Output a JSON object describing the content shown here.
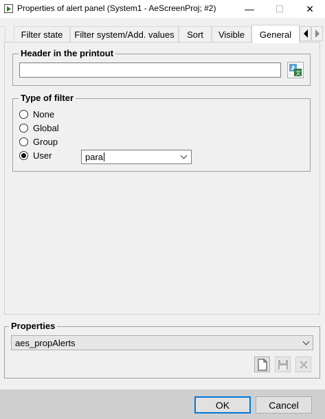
{
  "window": {
    "title": "Properties of alert panel (System1 - AeScreenProj; #2)",
    "minimize_glyph": "—",
    "maximize_glyph": "☐",
    "close_glyph": "✕"
  },
  "tabs": [
    {
      "label": "Filter state"
    },
    {
      "label": "Filter system/Add. values"
    },
    {
      "label": "Sort"
    },
    {
      "label": "Visible"
    },
    {
      "label": "General",
      "active": true
    }
  ],
  "header_group": {
    "title": "Header in the printout",
    "value": "",
    "translate_icon": "translate-icon"
  },
  "filter_group": {
    "title": "Type of filter",
    "options": [
      {
        "label": "None",
        "checked": false
      },
      {
        "label": "Global",
        "checked": false
      },
      {
        "label": "Group",
        "checked": false
      },
      {
        "label": "User",
        "checked": true
      }
    ],
    "user_value": "para"
  },
  "properties_group": {
    "title": "Properties",
    "selected": "aes_propAlerts",
    "icons": [
      "new-document-icon",
      "save-icon",
      "delete-icon"
    ]
  },
  "buttons": {
    "ok": "OK",
    "cancel": "Cancel"
  },
  "colors": {
    "accent": "#0078d7",
    "window_bg": "#f0f0f0",
    "footer_bg": "#cfcfcf"
  }
}
